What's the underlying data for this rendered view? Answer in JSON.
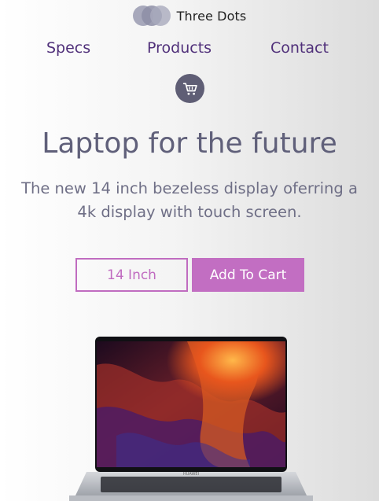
{
  "brand": {
    "name": "Three Dots",
    "logo_icon": "three-circles-logo"
  },
  "nav": {
    "items": [
      "Specs",
      "Products",
      "Contact"
    ]
  },
  "cart_icon": "shopping-cart-icon",
  "hero": {
    "title": "Laptop for the future",
    "subtitle": "The new 14 inch bezeless display oferring a 4k display with touch screen."
  },
  "actions": {
    "size_label": "14 Inch",
    "add_to_cart_label": "Add To Cart"
  },
  "colors": {
    "accent": "#c26ec2",
    "nav": "#50307a",
    "heading": "#60607a",
    "cart_bg": "#5f5e75"
  },
  "product_image": {
    "brand_on_device": "HUAWEI"
  }
}
